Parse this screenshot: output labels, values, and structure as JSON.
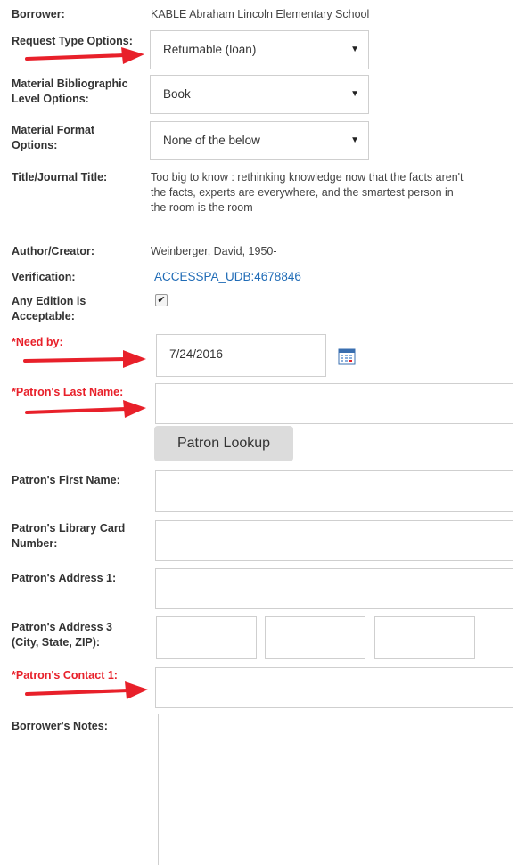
{
  "form": {
    "borrower": {
      "label": "Borrower:",
      "value": "KABLE Abraham Lincoln Elementary School"
    },
    "request_type": {
      "label": "Request Type Options:",
      "value": "Returnable (loan)"
    },
    "bib_level": {
      "label1": "Material Bibliographic",
      "label2": "Level Options:",
      "value": "Book"
    },
    "material_format": {
      "label1": "Material Format",
      "label2": "Options:",
      "value": "None of the below"
    },
    "title": {
      "label": "Title/Journal Title:",
      "line1": "Too big to know : rethinking knowledge now that the facts aren't",
      "line2": "the facts, experts are everywhere, and the smartest person in",
      "line3": "the room is the room"
    },
    "author": {
      "label": "Author/Creator:",
      "value": "Weinberger, David, 1950-"
    },
    "verification": {
      "label": "Verification:",
      "value": "ACCESSPA_UDB:4678846"
    },
    "any_edition": {
      "label1": "Any Edition is",
      "label2": "Acceptable:",
      "checked": true
    },
    "need_by": {
      "label": "*Need by:",
      "value": "7/24/2016"
    },
    "patron_last": {
      "label": "*Patron's Last Name:",
      "value": ""
    },
    "patron_lookup": {
      "label": "Patron Lookup"
    },
    "patron_first": {
      "label": "Patron's First Name:",
      "value": ""
    },
    "patron_card": {
      "label1": "Patron's Library Card",
      "label2": "Number:",
      "value": ""
    },
    "patron_addr1": {
      "label": "Patron's Address 1:",
      "value": ""
    },
    "patron_addr3": {
      "label1": "Patron's Address 3",
      "label2": "(City, State, ZIP):",
      "city": "",
      "state": "",
      "zip": ""
    },
    "patron_contact": {
      "label": "*Patron's Contact 1:",
      "value": ""
    },
    "notes": {
      "label": "Borrower's Notes:",
      "value": ""
    }
  },
  "icons": {
    "calendar": "calendar-icon",
    "caret": "chevron-down-icon",
    "check": "check-icon",
    "arrow": "red-arrow-annotation"
  },
  "colors": {
    "required": "#e8202a",
    "link": "#1f6bb6",
    "arrow": "#e8202a"
  }
}
